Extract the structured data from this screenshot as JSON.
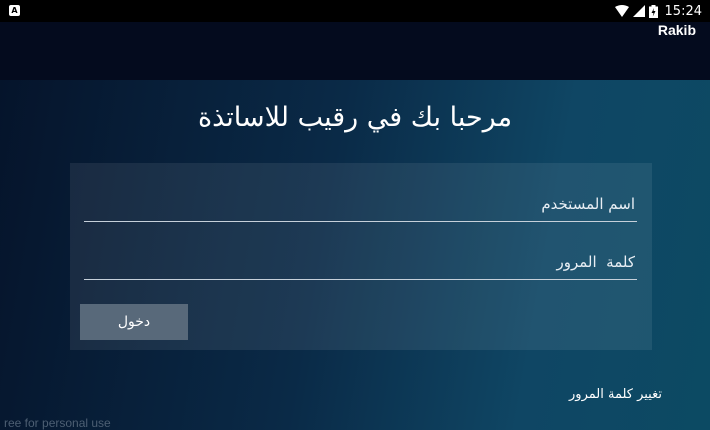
{
  "status_bar": {
    "notification_icon": "A",
    "time": "15:24",
    "icons": [
      "wifi-icon",
      "signal-icon",
      "battery-icon"
    ]
  },
  "app_bar": {
    "title": "Rakib"
  },
  "main": {
    "welcome": "مرحبا بك في رقيب للاساتذة",
    "username_placeholder": "اسم المستخدم",
    "password_placeholder": "كلمة  المرور",
    "login_label": "دخول",
    "change_password": "تغيير كلمة المرور"
  },
  "watermark": "ree for personal use",
  "colors": {
    "button": "#58697a",
    "gradient_start": "#05142b",
    "gradient_end": "#0c4a63"
  }
}
